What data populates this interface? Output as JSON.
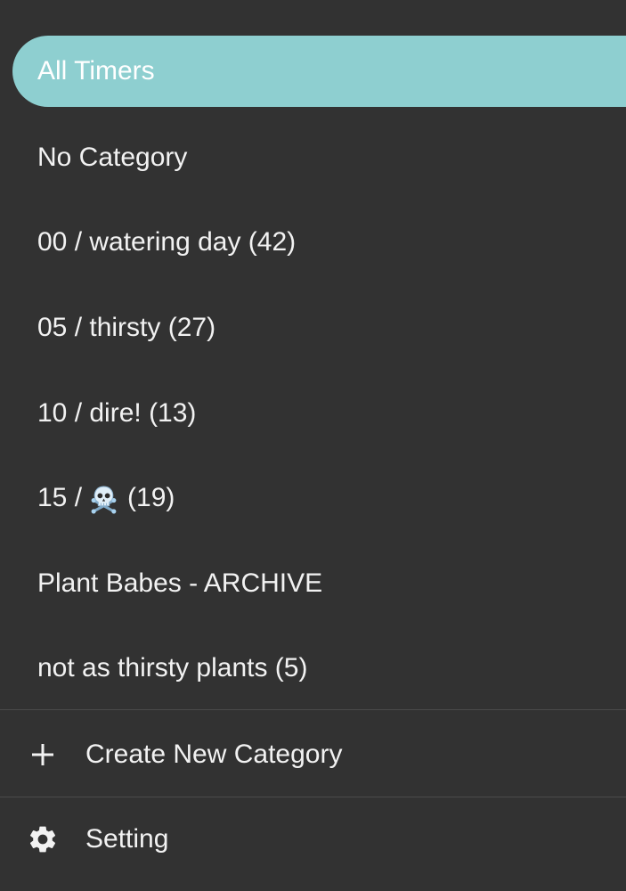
{
  "drawer": {
    "active_item": {
      "label": "All Timers"
    },
    "categories": [
      {
        "label": "No Category"
      },
      {
        "label": "00 / watering day (42)"
      },
      {
        "label": "05 / thirsty (27)"
      },
      {
        "label": "10 / dire! (13)"
      },
      {
        "prefix": "15 /",
        "icon": "skull-crossbones-icon",
        "suffix": "(19)"
      },
      {
        "label": "Plant Babes - ARCHIVE"
      },
      {
        "label": "not as thirsty plants (5)"
      }
    ],
    "actions": {
      "create": {
        "icon": "plus-icon",
        "label": "Create New Category"
      },
      "settings": {
        "icon": "gear-icon",
        "label": "Setting"
      }
    }
  },
  "colors": {
    "background": "#323232",
    "active_background": "#8ecfd0",
    "text": "#f2f2f2",
    "divider": "#4a4a4a"
  }
}
